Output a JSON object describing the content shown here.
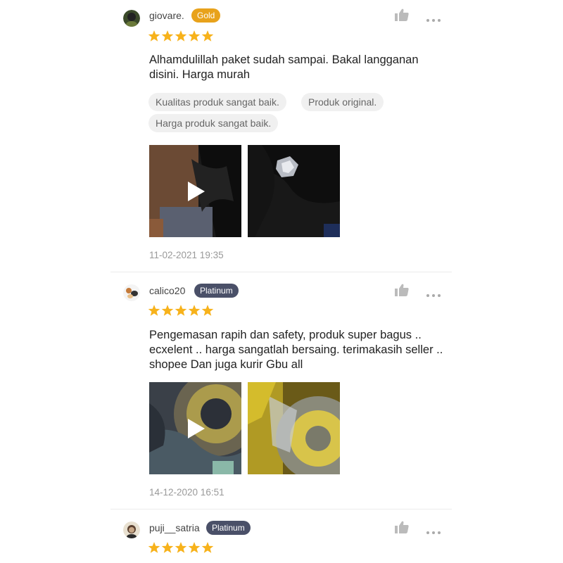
{
  "reviews": [
    {
      "username": "giovare.",
      "badge": "Gold",
      "rating": 5,
      "text": "Alhamdulillah paket sudah sampai. Bakal langganan disini. Harga murah",
      "tags": [
        "Kualitas produk sangat baik.",
        "Produk original.",
        "Harga produk sangat baik."
      ],
      "media": [
        {
          "type": "video",
          "description": "black plastic packaging"
        },
        {
          "type": "image",
          "description": "black plastic with silver foil"
        }
      ],
      "date": "11-02-2021 19:35"
    },
    {
      "username": "calico20",
      "badge": "Platinum",
      "rating": 5,
      "text": "Pengemasan rapih dan safety, produk super bagus .. ecxelent .. harga sangatlah bersaing. terimakasih seller .. shopee Dan juga kurir Gbu all",
      "media": [
        {
          "type": "video",
          "description": "tape roll in bubble wrap"
        },
        {
          "type": "image",
          "description": "yellow tape roll"
        }
      ],
      "date": "14-12-2020 16:51"
    },
    {
      "username": "puji__satria",
      "badge": "Platinum",
      "rating": 5
    }
  ],
  "colors": {
    "star": "#f7b21b",
    "gold_badge": "#e8a21b",
    "platinum_badge": "#4a5068"
  },
  "icons": {
    "like": "thumbs-up-icon",
    "more": "more-dots-icon",
    "play": "play-icon",
    "star": "star-icon"
  }
}
